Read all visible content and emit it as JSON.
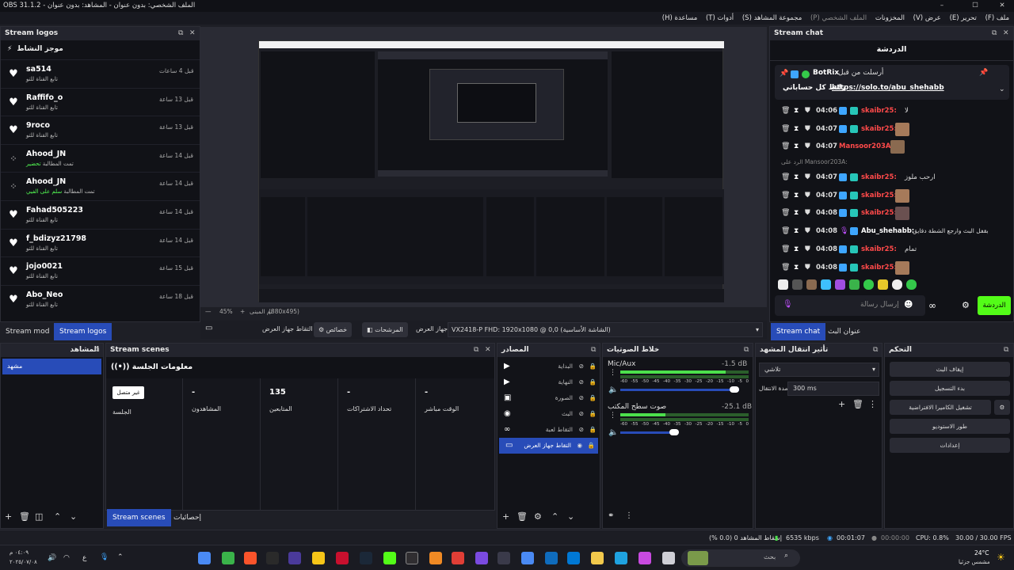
{
  "window": {
    "title": "OBS 31.1.2 - الملف الشخصي: بدون عنوان - المشاهد: بدون عنوان"
  },
  "menu": [
    {
      "label": "ملف (F)"
    },
    {
      "label": "تحرير (E)"
    },
    {
      "label": "عرض (V)"
    },
    {
      "label": "المخزونات"
    },
    {
      "label": "الملف الشخصي (P)"
    },
    {
      "label": "مجموعة المشاهد (S)"
    },
    {
      "label": "أدوات (T)"
    },
    {
      "label": "مساعدة (H)"
    }
  ],
  "activity": {
    "dock_title": "Stream logos",
    "feed_title": "موجز النشاط",
    "items": [
      {
        "icon": "heart-icon",
        "user": "sa514",
        "sub": "تابع القناة للتو",
        "time": "قبل 4 ساعات"
      },
      {
        "icon": "heart-icon",
        "user": "Raffifo_o",
        "sub": "تابع القناة للتو",
        "time": "قبل 13 ساعة"
      },
      {
        "icon": "heart-icon",
        "user": "9roco",
        "sub": "تابع القناة للتو",
        "time": "قبل 13 ساعة"
      },
      {
        "icon": "redeem-icon",
        "user": "Ahood_JN",
        "sub": "تمت المطالبة",
        "highlight": "تحضير",
        "time": "قبل 14 ساعة"
      },
      {
        "icon": "redeem-icon",
        "user": "Ahood_JN",
        "sub": "تمت المطالبة",
        "highlight": "سلم على الفيي",
        "time": "قبل 14 ساعة"
      },
      {
        "icon": "heart-icon",
        "user": "Fahad505223",
        "sub": "تابع القناة للتو",
        "time": "قبل 14 ساعة"
      },
      {
        "icon": "heart-icon",
        "user": "f_bdizyz21798",
        "sub": "تابع القناة للتو",
        "time": "قبل 14 ساعة"
      },
      {
        "icon": "heart-icon",
        "user": "jojo0021",
        "sub": "تابع القناة للتو",
        "time": "قبل 15 ساعة"
      },
      {
        "icon": "heart-icon",
        "user": "Abo_Neo",
        "sub": "تابع القناة للتو",
        "time": "قبل 18 ساعة"
      }
    ],
    "tabs": [
      "Stream mod",
      "Stream logos"
    ]
  },
  "preview": {
    "zoom": "45%",
    "canvas": "(880x495)",
    "fit": "تم المبنى"
  },
  "controls": {
    "source_label": "التقاط جهاز العرض",
    "properties": "خصائص",
    "filters": "المرشحات",
    "device_label": "جهاز العرض",
    "device_value": "VX2418-P FHD: 1920x1080 @ 0,0 (الشاشة الأساسية)"
  },
  "chat": {
    "dock_title": "Stream chat",
    "header": "الدردشة",
    "pinned_user": "BotRix",
    "pinned_prefix": "أرسلت من قبل",
    "pinned_text": "رابط كل حساباتي",
    "pinned_link": "https://solo.to/abu_shehabb",
    "lines": [
      {
        "time": "04:06",
        "user": "skaibr25:",
        "msg": "لا"
      },
      {
        "time": "04:07",
        "user": "skaibr25:",
        "msg": ""
      },
      {
        "time": "04:07",
        "user": "Mansoor203A:",
        "msg": ""
      },
      {
        "reply": "الرد على Mansoor203A:"
      },
      {
        "time": "04:07",
        "user": "skaibr25:",
        "msg": "ارحب ملوز"
      },
      {
        "time": "04:07",
        "user": "skaibr25:",
        "msg": ""
      },
      {
        "time": "04:08",
        "user": "skaibr25:",
        "msg": ""
      },
      {
        "time": "04:08",
        "user": "Abu_shehabb:",
        "msg": "بقفل البث وارجع الشطة دقايق",
        "white": true
      },
      {
        "time": "04:08",
        "user": "skaibr25:",
        "msg": "تمام"
      },
      {
        "time": "04:08",
        "user": "skaibr25:",
        "msg": ""
      }
    ],
    "input_placeholder": "إرسال رسالة",
    "send_button": "الدردشة",
    "tabs": [
      "Stream chat",
      "عنوان البث"
    ]
  },
  "scenes": {
    "title": "المشاهد",
    "items": [
      "مشهد"
    ]
  },
  "stream_scenes": {
    "title": "Stream scenes",
    "session_title": "معلومات الجلسة",
    "badge": "غير متصل",
    "stats": [
      {
        "value": "",
        "label": "الجلسة"
      },
      {
        "value": "-",
        "label": "المشاهدون"
      },
      {
        "value": "135",
        "label": "المتابعين"
      },
      {
        "value": "-",
        "label": "تحداد الاشتراكات"
      },
      {
        "value": "-",
        "label": "الوقت مباشر"
      }
    ],
    "tabs": [
      "Stream scenes",
      "إحصائيات"
    ]
  },
  "sources": {
    "title": "المصادر",
    "items": [
      {
        "icon": "play-icon",
        "name": "البداية"
      },
      {
        "icon": "play-icon",
        "name": "النهاية"
      },
      {
        "icon": "image-icon",
        "name": "الصورة"
      },
      {
        "icon": "browser-icon",
        "name": "البث"
      },
      {
        "icon": "gamepad-icon",
        "name": "التقاط لعبة"
      },
      {
        "icon": "monitor-icon",
        "name": "التقاط جهاز العرض",
        "selected": true
      }
    ]
  },
  "mixer": {
    "title": "خلاط الصوتيات",
    "channels": [
      {
        "name": "Mic/Aux",
        "db": "-1.5 dB",
        "level": 0.82
      },
      {
        "name": "صوت سطح المكتب",
        "db": "-25.1 dB",
        "level": 0.35
      }
    ],
    "scale": [
      "-60",
      "-55",
      "-50",
      "-45",
      "-40",
      "-35",
      "-30",
      "-25",
      "-20",
      "-15",
      "-10",
      "-5",
      "0"
    ]
  },
  "transitions": {
    "title": "تأثير انتقال المشهد",
    "type": "تلاشي",
    "duration_label": "مدة الانتقال",
    "duration": "300 ms"
  },
  "controlsdock": {
    "title": "التحكم",
    "buttons": [
      "إيقاف البث",
      "بدء التسجيل",
      "تشغيل الكاميرا الافتراضية",
      "طور الاستوديو",
      "إعدادات"
    ]
  },
  "status": {
    "dropped": "إسقاط المشاهد 0 (0.0 %)",
    "bitrate": "6535 kbps",
    "live": "00:01:07",
    "rec": "00:00:00",
    "cpu": "CPU: 0.8%",
    "fps": "30.00 / 30.00 FPS"
  },
  "taskbar": {
    "time": "٠٤:٠٩ م",
    "date": "٢٠٢٥/٠٧/٠٨",
    "lang": "ع",
    "weather_temp": "24°C",
    "weather_desc": "مشمس جزئيا",
    "search": "بحث"
  }
}
